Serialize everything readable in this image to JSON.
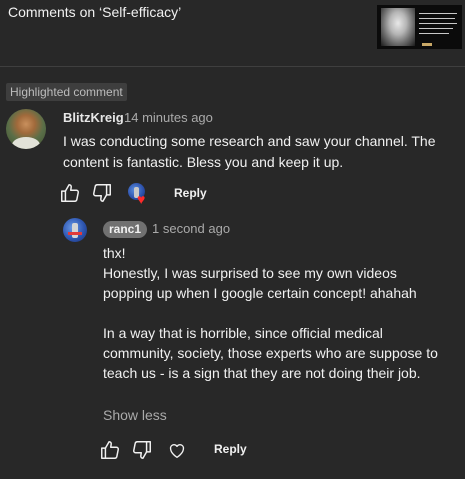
{
  "header": {
    "title": "Comments on ‘Self-efficacy’",
    "thumbnail": "video-thumbnail-portrait"
  },
  "highlighted_label": "Highlighted comment",
  "comment": {
    "author": "BlitzKreig",
    "time": "14 minutes ago",
    "text": "I was conducting some research and saw your channel. The content is fantastic. Bless you and keep it up.",
    "actions": {
      "like_icon": "thumbs-up-icon",
      "dislike_icon": "thumbs-down-icon",
      "hearted_icon": "creator-heart-icon",
      "reply_label": "Reply"
    }
  },
  "reply": {
    "author": "ranc1",
    "time": "1 second ago",
    "paragraphs": [
      "thx!",
      "Honestly, I was surprised to see my own videos popping up when I google certain concept! ahahah",
      "In a way that is horrible, since official medical community, society, those experts who are suppose to teach us - is a sign that they are not doing their job."
    ],
    "show_less_label": "Show less",
    "actions": {
      "like_icon": "thumbs-up-icon",
      "dislike_icon": "thumbs-down-icon",
      "heart_icon": "heart-outline-icon",
      "reply_label": "Reply"
    }
  },
  "colors": {
    "background": "#282828",
    "text": "#f1f1f1",
    "secondary": "#aaaaaa",
    "heart": "#ff2a2a",
    "chip": "#717171"
  }
}
